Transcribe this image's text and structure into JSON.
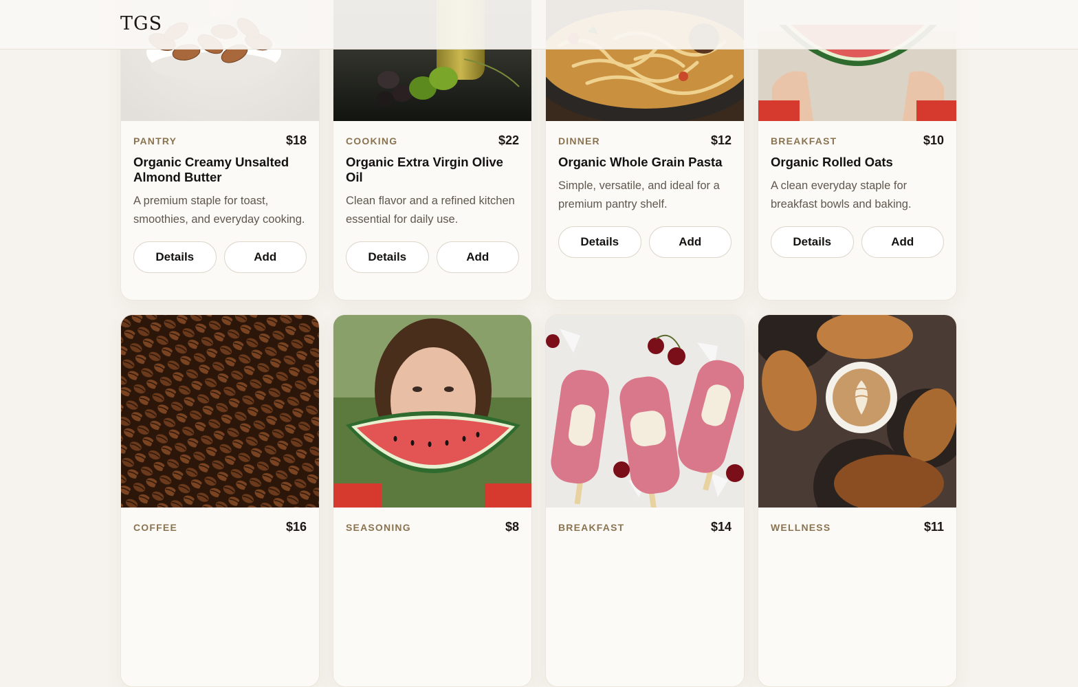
{
  "header": {
    "logo": "TGS"
  },
  "labels": {
    "details": "Details",
    "add": "Add"
  },
  "products": [
    {
      "category": "PANTRY",
      "price": "$18",
      "title": "Organic Creamy Unsalted Almond Butter",
      "description": "A premium staple for toast, smoothies, and everyday cooking.",
      "image": "almonds-bowl"
    },
    {
      "category": "COOKING",
      "price": "$22",
      "title": "Organic Extra Virgin Olive Oil",
      "description": "Clean flavor and a refined kitchen essential for daily use.",
      "image": "olives-oil"
    },
    {
      "category": "DINNER",
      "price": "$12",
      "title": "Organic Whole Grain Pasta",
      "description": "Simple, versatile, and ideal for a premium pantry shelf.",
      "image": "pasta-pan"
    },
    {
      "category": "BREAKFAST",
      "price": "$10",
      "title": "Organic Rolled Oats",
      "description": "A clean everyday staple for breakfast bowls and baking.",
      "image": "watermelon-held"
    },
    {
      "category": "COFFEE",
      "price": "$16",
      "title": "",
      "description": "",
      "image": "coffee-beans"
    },
    {
      "category": "SEASONING",
      "price": "$8",
      "title": "",
      "description": "",
      "image": "woman-watermelon"
    },
    {
      "category": "BREAKFAST",
      "price": "$14",
      "title": "",
      "description": "",
      "image": "popsicles-cherries"
    },
    {
      "category": "WELLNESS",
      "price": "$11",
      "title": "",
      "description": "",
      "image": "latte-croissants"
    }
  ]
}
